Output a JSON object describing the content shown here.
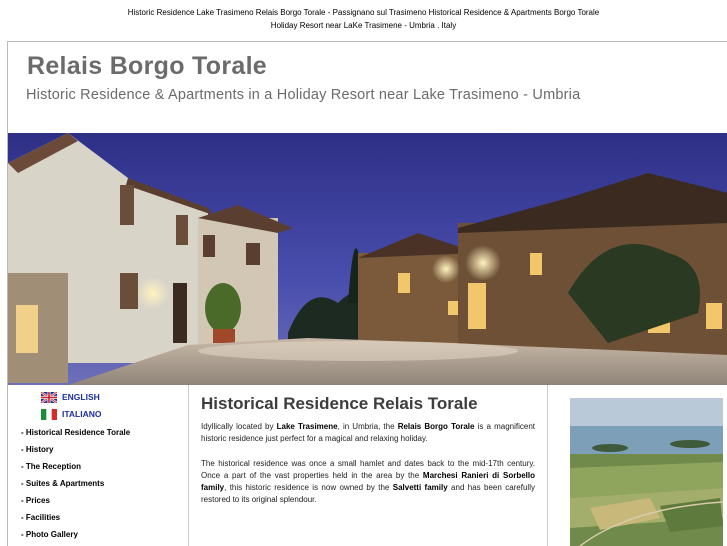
{
  "top_caption": {
    "line1": "Historic Residence Lake Trasimeno Relais Borgo Torale - Passignano sul Trasimeno Historical Residence & Apartments Borgo Torale",
    "line2": "Holiday Resort near LaKe Trasimene - Umbria . Italy"
  },
  "header": {
    "title": "Relais Borgo Torale",
    "subtitle": "Historic Residence & Apartments in a Holiday Resort near Lake Trasimeno - Umbria"
  },
  "languages": [
    {
      "label": "ENGLISH",
      "flag": "uk-flag-icon"
    },
    {
      "label": "ITALIANO",
      "flag": "italy-flag-icon"
    }
  ],
  "nav": [
    "- Historical Residence Torale",
    "- History",
    "- The Reception",
    "- Suites & Apartments",
    "- Prices",
    "- Facilities",
    "- Photo Gallery"
  ],
  "main": {
    "heading": "Historical Residence Relais Torale",
    "p1": {
      "a": "Idyllically located by ",
      "b": "Lake Trasimene",
      "c": ", in Umbria, the ",
      "d": "Relais Borgo Torale",
      "e": " is a magnificent historic residence just perfect for a magical and relaxing holiday."
    },
    "p2": {
      "a": "The historical residence was once a small hamlet and dates back to the mid-17th century. Once a part of the vast properties held in the area by the ",
      "b": "Marchesi Ranieri di Sorbello family",
      "c": ", this historic residence is now owned by the ",
      "d": "Salvetti family",
      "e": " and has been carefully restored to its original splendour."
    }
  },
  "colors": {
    "title_gray": "#6b6b6b",
    "link_blue": "#1c2f9c",
    "sky": "#3b3f9a"
  }
}
